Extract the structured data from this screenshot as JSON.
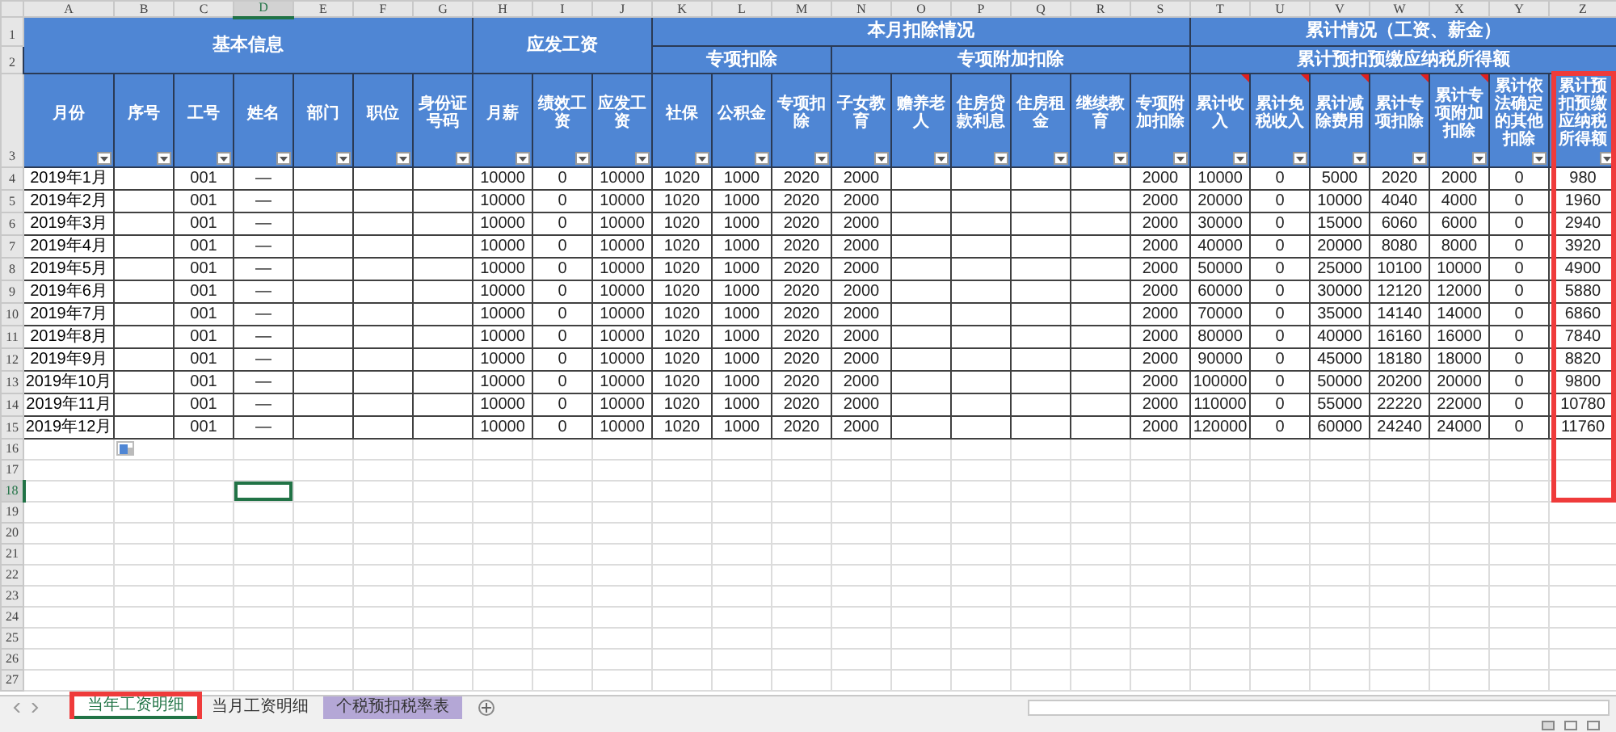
{
  "column_letters": [
    {
      "label": "A",
      "selected": false
    },
    {
      "label": "B",
      "selected": false
    },
    {
      "label": "C",
      "selected": false
    },
    {
      "label": "D",
      "selected": true
    },
    {
      "label": "E",
      "selected": false
    },
    {
      "label": "F",
      "selected": false
    },
    {
      "label": "G",
      "selected": false
    },
    {
      "label": "H",
      "selected": false
    },
    {
      "label": "I",
      "selected": false
    },
    {
      "label": "J",
      "selected": false
    },
    {
      "label": "K",
      "selected": false
    },
    {
      "label": "L",
      "selected": false
    },
    {
      "label": "M",
      "selected": false
    },
    {
      "label": "N",
      "selected": false
    },
    {
      "label": "O",
      "selected": false
    },
    {
      "label": "P",
      "selected": false
    },
    {
      "label": "Q",
      "selected": false
    },
    {
      "label": "R",
      "selected": false
    },
    {
      "label": "S",
      "selected": false
    },
    {
      "label": "T",
      "selected": false
    },
    {
      "label": "U",
      "selected": false
    },
    {
      "label": "V",
      "selected": false
    },
    {
      "label": "W",
      "selected": false
    },
    {
      "label": "X",
      "selected": false
    },
    {
      "label": "Y",
      "selected": false
    },
    {
      "label": "Z",
      "selected": false
    }
  ],
  "header_row_numbers": [
    "1",
    "2",
    "3"
  ],
  "column_groups": [
    {
      "label": "基本信息",
      "columns": [
        {
          "label": "月份",
          "comment": false,
          "highlighted": false
        },
        {
          "label": "序号",
          "comment": false,
          "highlighted": false
        },
        {
          "label": "工号",
          "comment": false,
          "highlighted": false
        },
        {
          "label": "姓名",
          "comment": false,
          "highlighted": false
        },
        {
          "label": "部门",
          "comment": false,
          "highlighted": false
        },
        {
          "label": "职位",
          "comment": false,
          "highlighted": false
        },
        {
          "label": "身份证号码",
          "comment": false,
          "highlighted": false
        }
      ]
    },
    {
      "label": "应发工资",
      "columns": [
        {
          "label": "月薪",
          "comment": false,
          "highlighted": false
        },
        {
          "label": "绩效工资",
          "comment": false,
          "highlighted": false
        },
        {
          "label": "应发工资",
          "comment": false,
          "highlighted": false
        }
      ]
    },
    {
      "label": "本月扣除情况",
      "subgroups": [
        {
          "label": "专项扣除",
          "columns": [
            {
              "label": "社保",
              "comment": false,
              "highlighted": false
            },
            {
              "label": "公积金",
              "comment": false,
              "highlighted": false
            },
            {
              "label": "专项扣除",
              "comment": false,
              "highlighted": false
            }
          ]
        },
        {
          "label": "专项附加扣除",
          "columns": [
            {
              "label": "子女教育",
              "comment": false,
              "highlighted": false
            },
            {
              "label": "赡养老人",
              "comment": false,
              "highlighted": false
            },
            {
              "label": "住房贷款利息",
              "comment": false,
              "highlighted": false
            },
            {
              "label": "住房租金",
              "comment": false,
              "highlighted": false
            },
            {
              "label": "继续教育",
              "comment": false,
              "highlighted": false
            },
            {
              "label": "专项附加扣除",
              "comment": false,
              "highlighted": false
            }
          ]
        }
      ]
    },
    {
      "label": "累计情况（工资、薪金）",
      "subgroups": [
        {
          "label": "累计预扣预缴应纳税所得额",
          "columns": [
            {
              "label": "累计收入",
              "comment": true,
              "highlighted": false
            },
            {
              "label": "累计免税收入",
              "comment": true,
              "highlighted": false
            },
            {
              "label": "累计减除费用",
              "comment": true,
              "highlighted": false
            },
            {
              "label": "累计专项扣除",
              "comment": true,
              "highlighted": false
            },
            {
              "label": "累计专项附加扣除",
              "comment": true,
              "highlighted": false
            },
            {
              "label": "累计依法确定的其他扣除",
              "comment": false,
              "highlighted": false
            },
            {
              "label": "累计预扣预缴应纳税所得额",
              "comment": false,
              "highlighted": true
            }
          ]
        }
      ]
    }
  ],
  "rows": [
    {
      "number": "4",
      "cells": [
        "2019年1月",
        null,
        "001",
        "—",
        null,
        null,
        null,
        "10000",
        "0",
        "10000",
        "1020",
        "1000",
        "2020",
        "2000",
        null,
        null,
        null,
        null,
        "2000",
        "10000",
        "0",
        "5000",
        "2020",
        "2000",
        "0",
        "980"
      ]
    },
    {
      "number": "5",
      "cells": [
        "2019年2月",
        null,
        "001",
        "—",
        null,
        null,
        null,
        "10000",
        "0",
        "10000",
        "1020",
        "1000",
        "2020",
        "2000",
        null,
        null,
        null,
        null,
        "2000",
        "20000",
        "0",
        "10000",
        "4040",
        "4000",
        "0",
        "1960"
      ]
    },
    {
      "number": "6",
      "cells": [
        "2019年3月",
        null,
        "001",
        "—",
        null,
        null,
        null,
        "10000",
        "0",
        "10000",
        "1020",
        "1000",
        "2020",
        "2000",
        null,
        null,
        null,
        null,
        "2000",
        "30000",
        "0",
        "15000",
        "6060",
        "6000",
        "0",
        "2940"
      ]
    },
    {
      "number": "7",
      "cells": [
        "2019年4月",
        null,
        "001",
        "—",
        null,
        null,
        null,
        "10000",
        "0",
        "10000",
        "1020",
        "1000",
        "2020",
        "2000",
        null,
        null,
        null,
        null,
        "2000",
        "40000",
        "0",
        "20000",
        "8080",
        "8000",
        "0",
        "3920"
      ]
    },
    {
      "number": "8",
      "cells": [
        "2019年5月",
        null,
        "001",
        "—",
        null,
        null,
        null,
        "10000",
        "0",
        "10000",
        "1020",
        "1000",
        "2020",
        "2000",
        null,
        null,
        null,
        null,
        "2000",
        "50000",
        "0",
        "25000",
        "10100",
        "10000",
        "0",
        "4900"
      ]
    },
    {
      "number": "9",
      "cells": [
        "2019年6月",
        null,
        "001",
        "—",
        null,
        null,
        null,
        "10000",
        "0",
        "10000",
        "1020",
        "1000",
        "2020",
        "2000",
        null,
        null,
        null,
        null,
        "2000",
        "60000",
        "0",
        "30000",
        "12120",
        "12000",
        "0",
        "5880"
      ]
    },
    {
      "number": "10",
      "cells": [
        "2019年7月",
        null,
        "001",
        "—",
        null,
        null,
        null,
        "10000",
        "0",
        "10000",
        "1020",
        "1000",
        "2020",
        "2000",
        null,
        null,
        null,
        null,
        "2000",
        "70000",
        "0",
        "35000",
        "14140",
        "14000",
        "0",
        "6860"
      ]
    },
    {
      "number": "11",
      "cells": [
        "2019年8月",
        null,
        "001",
        "—",
        null,
        null,
        null,
        "10000",
        "0",
        "10000",
        "1020",
        "1000",
        "2020",
        "2000",
        null,
        null,
        null,
        null,
        "2000",
        "80000",
        "0",
        "40000",
        "16160",
        "16000",
        "0",
        "7840"
      ]
    },
    {
      "number": "12",
      "cells": [
        "2019年9月",
        null,
        "001",
        "—",
        null,
        null,
        null,
        "10000",
        "0",
        "10000",
        "1020",
        "1000",
        "2020",
        "2000",
        null,
        null,
        null,
        null,
        "2000",
        "90000",
        "0",
        "45000",
        "18180",
        "18000",
        "0",
        "8820"
      ]
    },
    {
      "number": "13",
      "cells": [
        "2019年10月",
        null,
        "001",
        "—",
        null,
        null,
        null,
        "10000",
        "0",
        "10000",
        "1020",
        "1000",
        "2020",
        "2000",
        null,
        null,
        null,
        null,
        "2000",
        "100000",
        "0",
        "50000",
        "20200",
        "20000",
        "0",
        "9800"
      ]
    },
    {
      "number": "14",
      "cells": [
        "2019年11月",
        null,
        "001",
        "—",
        null,
        null,
        null,
        "10000",
        "0",
        "10000",
        "1020",
        "1000",
        "2020",
        "2000",
        null,
        null,
        null,
        null,
        "2000",
        "110000",
        "0",
        "55000",
        "22220",
        "22000",
        "0",
        "10780"
      ]
    },
    {
      "number": "15",
      "cells": [
        "2019年12月",
        null,
        "001",
        "—",
        null,
        null,
        null,
        "10000",
        "0",
        "10000",
        "1020",
        "1000",
        "2020",
        "2000",
        null,
        null,
        null,
        null,
        "2000",
        "120000",
        "0",
        "60000",
        "24240",
        "24000",
        "0",
        "11760"
      ]
    }
  ],
  "empty_rows": [
    {
      "number": "16",
      "selected": false
    },
    {
      "number": "17",
      "selected": false
    },
    {
      "number": "18",
      "selected": true
    },
    {
      "number": "19",
      "selected": false
    },
    {
      "number": "20",
      "selected": false
    },
    {
      "number": "21",
      "selected": false
    },
    {
      "number": "22",
      "selected": false
    },
    {
      "number": "23",
      "selected": false
    },
    {
      "number": "24",
      "selected": false
    },
    {
      "number": "25",
      "selected": false
    },
    {
      "number": "26",
      "selected": false
    },
    {
      "number": "27",
      "selected": false
    }
  ],
  "sheet_tabs": [
    {
      "label": "当年工资明细",
      "selected": true,
      "highlighted": true
    },
    {
      "label": "当月工资明细",
      "selected": false,
      "highlighted": false
    },
    {
      "label": "个税预扣税率表",
      "selected": false,
      "highlighted": false,
      "color": "#b4a7d6"
    }
  ]
}
